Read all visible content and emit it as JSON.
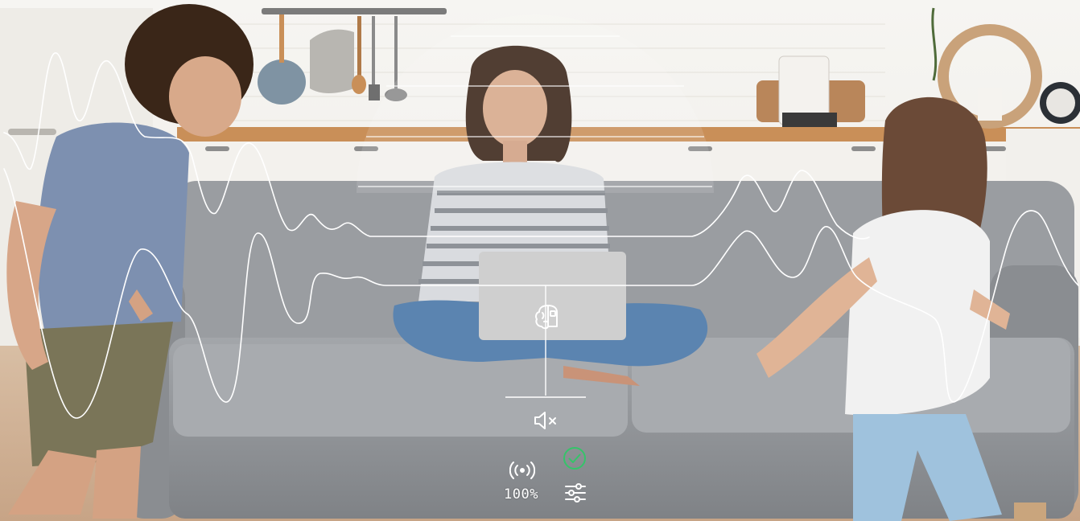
{
  "overlay": {
    "signal_strength_text": "100%",
    "status": "ok"
  },
  "icons": {
    "signal": "wireless-signal-icon",
    "mute": "speaker-mute-icon",
    "check": "check-circle-icon",
    "settings": "sliders-icon",
    "ai": "ai-brain-icon"
  },
  "colors": {
    "wall": "#f3f1ec",
    "counter_wood": "#c98f58",
    "cabinet": "#f4f2ee",
    "sofa": "#8d9094",
    "sofa_cushion": "#9ea1a5",
    "floor": "#d6b79a",
    "overlay_line": "#ffffff",
    "check": "#35c46a"
  }
}
